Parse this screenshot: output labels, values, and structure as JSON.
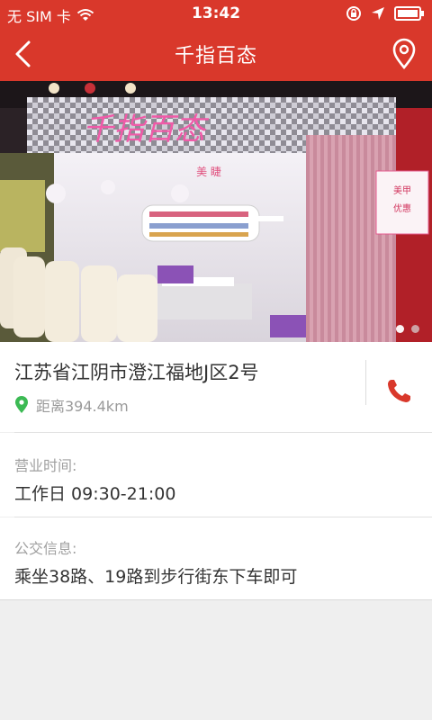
{
  "status_bar": {
    "carrier": "无 SIM 卡",
    "time": "13:42"
  },
  "navbar": {
    "title": "千指百态"
  },
  "banner": {
    "sign_text": "千指百态",
    "sub_sign": "美 睫",
    "pages": 2,
    "active_page": 1
  },
  "address": {
    "text": "江苏省江阴市澄江福地J区2号",
    "distance": "距离394.4km"
  },
  "hours": {
    "label": "营业时间:",
    "value": "工作日 09:30-21:00"
  },
  "transit": {
    "label": "公交信息:",
    "value": "乘坐38路、19路到步行街东下车即可"
  },
  "colors": {
    "brand_red": "#d9382b",
    "location_green": "#3cba54"
  }
}
